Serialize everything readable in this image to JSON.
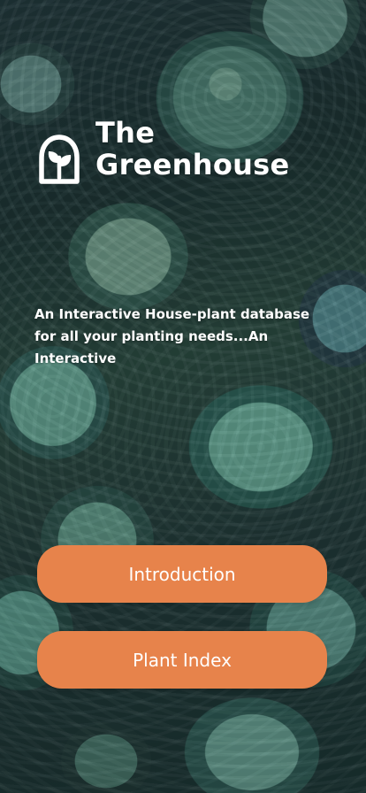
{
  "app": {
    "title_line1": "The",
    "title_line2": "Greenhouse",
    "tagline": "An Interactive House-plant database for all your planting needs...An Interactive"
  },
  "buttons": {
    "introduction": "Introduction",
    "plant_index": "Plant Index"
  },
  "icons": {
    "logo": "greenhouse-plant-logo-icon"
  },
  "colors": {
    "accent": "#e7834b",
    "text": "#ffffff"
  }
}
